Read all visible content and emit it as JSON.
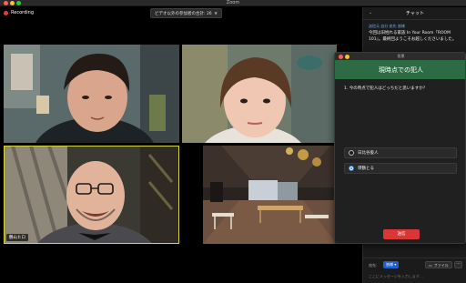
{
  "window": {
    "title": "Zoom"
  },
  "recording": {
    "label": "Recording"
  },
  "participants": {
    "label": "ビデオ以外の参加者の合計: 26"
  },
  "tiles": [
    {
      "name": ""
    },
    {
      "name": ""
    },
    {
      "name": "鶴山ヒロ"
    },
    {
      "name": ""
    }
  ],
  "chat": {
    "header": "チャット",
    "sender": "送信元 自分 宛先 皆様",
    "message": "今回は旧姓れる家族 In Your Room『ROOM 101』。最終回ようこそお越しくださいました。",
    "faded": "参加者は犯人が誰かを考えてください",
    "to_label": "宛先:",
    "to_value": "皆様",
    "file_label": "ファイル",
    "more_label": "···",
    "input_placeholder": "ここにメッセージを入力します..."
  },
  "poll": {
    "window_title": "投票",
    "banner": "現時点での犯人",
    "question": "1. 今の時点で犯人はどっちだと思いますか？",
    "options": [
      {
        "label": "日比谷俊人",
        "selected": false
      },
      {
        "label": "瑛鶴とる",
        "selected": true
      }
    ],
    "submit": "送信"
  },
  "colors": {
    "recording": "#e23b3b",
    "active_speaker_border": "#d4d63c",
    "poll_banner": "#2d6b44",
    "submit": "#d93737",
    "chat_to": "#1d5fd1"
  }
}
